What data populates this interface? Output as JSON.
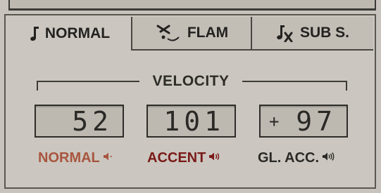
{
  "tabs": [
    {
      "label": "NORMAL",
      "icon": "single-note-icon"
    },
    {
      "label": "FLAM",
      "icon": "flam-drumstick-icon"
    },
    {
      "label": "SUB S.",
      "icon": "note-x-icon"
    }
  ],
  "velocity": {
    "title": "VELOCITY",
    "normal": {
      "value": "52",
      "label": "NORMAL"
    },
    "accent": {
      "value": "101",
      "label": "ACCENT"
    },
    "ghost": {
      "sign": "+",
      "value": "97",
      "label": "GL. ACC."
    }
  },
  "colors": {
    "panel": "#c8c4bd",
    "normal_label": "#a8553f",
    "accent_label": "#7a1a18",
    "text_dark": "#2b2926"
  },
  "label_icons": [
    "speaker-low-icon",
    "speaker-mid-icon",
    "speaker-high-icon"
  ]
}
